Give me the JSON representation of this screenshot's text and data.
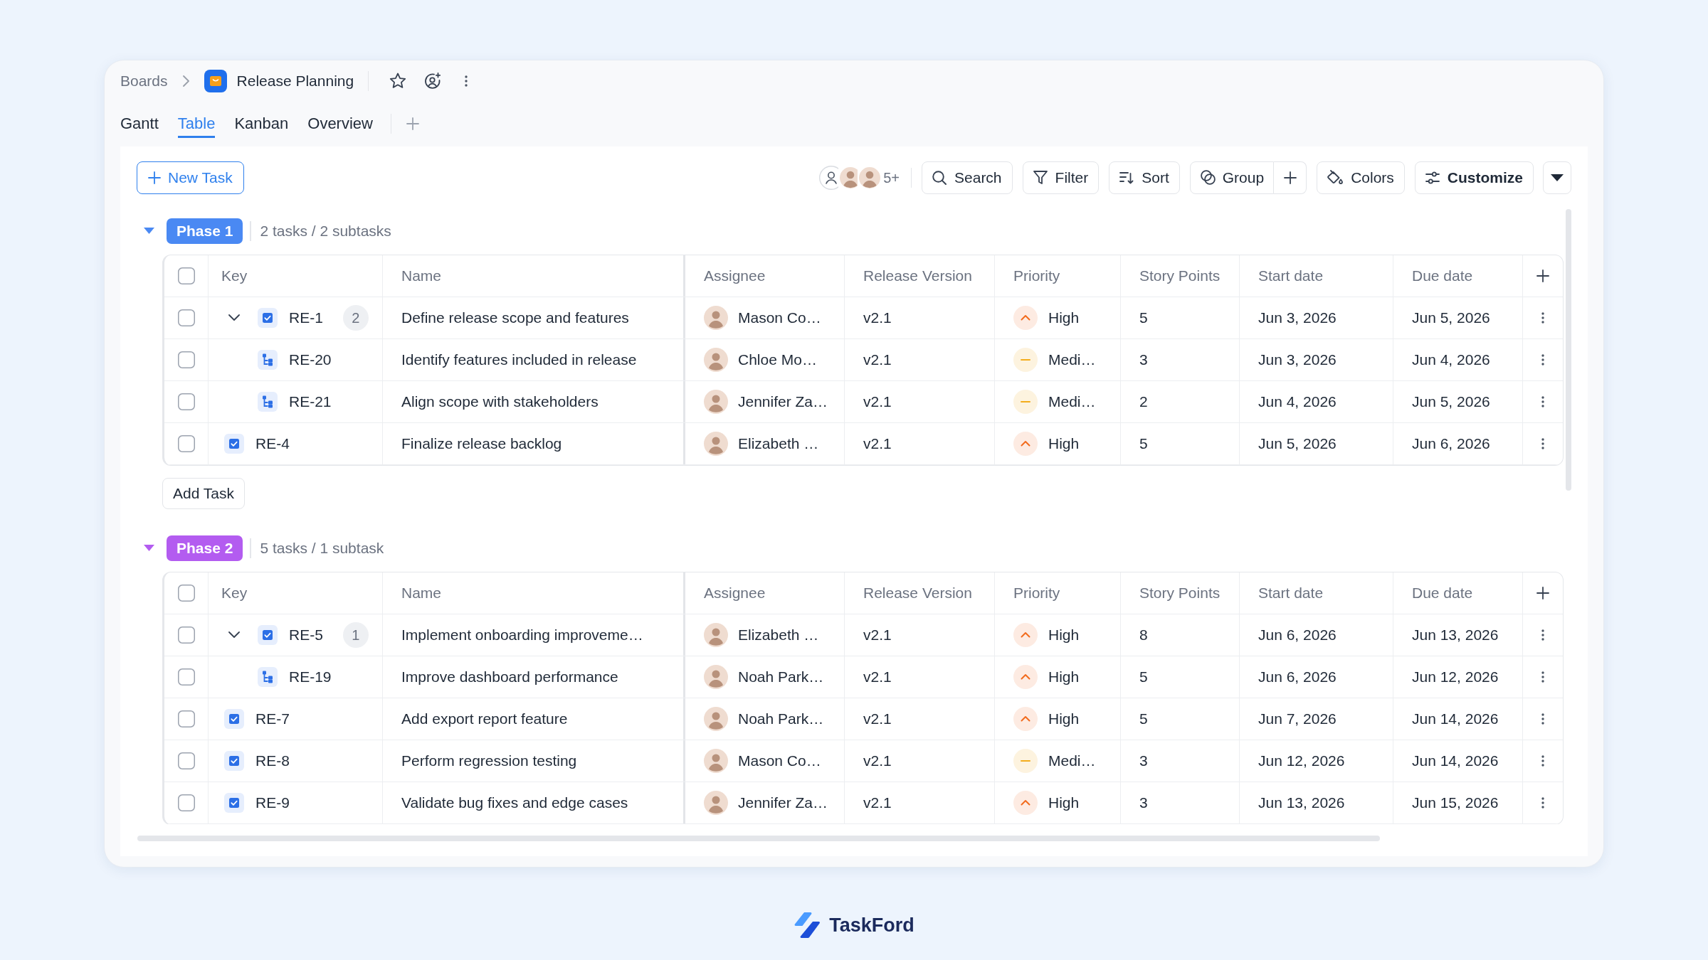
{
  "breadcrumb": {
    "parent": "Boards",
    "board": "Release Planning"
  },
  "tabs": [
    {
      "label": "Gantt",
      "selected": false
    },
    {
      "label": "Table",
      "selected": true
    },
    {
      "label": "Kanban",
      "selected": false
    },
    {
      "label": "Overview",
      "selected": false
    }
  ],
  "toolbar": {
    "new_task": "New Task",
    "members_more": "5+",
    "buttons": [
      {
        "kind": "search",
        "label": "Search"
      },
      {
        "kind": "filter",
        "label": "Filter"
      },
      {
        "kind": "sort",
        "label": "Sort"
      },
      {
        "kind": "group",
        "label": "Group"
      },
      {
        "kind": "colors",
        "label": "Colors"
      },
      {
        "kind": "customize",
        "label": "Customize"
      }
    ]
  },
  "groups": [
    {
      "label": "Phase 1",
      "color": "#4a89f3",
      "expanded": true,
      "summary": "2 tasks / 2 subtasks",
      "header_checked": false,
      "columns": [
        "Key",
        "Name",
        "Assignee",
        "Release Version",
        "Priority",
        "Story Points",
        "Start date",
        "Due date"
      ],
      "rows": [
        {
          "selected": false,
          "kind": "task",
          "key": "RE-1",
          "count": "2",
          "expanded": true,
          "name": "Define release scope and features",
          "assignee": "Mason Co…",
          "version": "v2.1",
          "priority": {
            "kind": "high",
            "label": "High"
          },
          "points": "5",
          "start": "Jun 3, 2026",
          "due": "Jun 5, 2026",
          "children": [
            {
              "selected": false,
              "kind": "subtask",
              "key": "RE-20",
              "name": "Identify features included in release",
              "assignee": "Chloe Mo…",
              "version": "v2.1",
              "priority": {
                "kind": "medium",
                "label": "Medi…"
              },
              "points": "3",
              "start": "Jun 3, 2026",
              "due": "Jun 4, 2026"
            },
            {
              "selected": false,
              "kind": "subtask",
              "key": "RE-21",
              "name": "Align scope with stakeholders",
              "assignee": "Jennifer Za…",
              "version": "v2.1",
              "priority": {
                "kind": "medium",
                "label": "Medi…"
              },
              "points": "2",
              "start": "Jun 4, 2026",
              "due": "Jun 5, 2026"
            }
          ]
        },
        {
          "selected": false,
          "kind": "task",
          "key": "RE-4",
          "name": "Finalize release backlog",
          "assignee": "Elizabeth …",
          "version": "v2.1",
          "priority": {
            "kind": "high",
            "label": "High"
          },
          "points": "5",
          "start": "Jun 5, 2026",
          "due": "Jun 6, 2026"
        }
      ],
      "add_task": "Add Task"
    },
    {
      "label": "Phase 2",
      "color": "#b35cf0",
      "expanded": true,
      "summary": "5 tasks / 1 subtask",
      "header_checked": false,
      "columns": [
        "Key",
        "Name",
        "Assignee",
        "Release Version",
        "Priority",
        "Story Points",
        "Start date",
        "Due date"
      ],
      "rows": [
        {
          "selected": false,
          "kind": "task",
          "key": "RE-5",
          "count": "1",
          "expanded": true,
          "name": "Implement onboarding improveme…",
          "assignee": "Elizabeth …",
          "version": "v2.1",
          "priority": {
            "kind": "high",
            "label": "High"
          },
          "points": "8",
          "start": "Jun 6, 2026",
          "due": "Jun 13, 2026",
          "children": [
            {
              "selected": false,
              "kind": "subtask",
              "key": "RE-19",
              "name": "Improve dashboard performance",
              "assignee": "Noah Park…",
              "version": "v2.1",
              "priority": {
                "kind": "high",
                "label": "High"
              },
              "points": "5",
              "start": "Jun 6, 2026",
              "due": "Jun 12, 2026"
            }
          ]
        },
        {
          "selected": false,
          "kind": "task",
          "key": "RE-7",
          "name": "Add export report feature",
          "assignee": "Noah Park…",
          "version": "v2.1",
          "priority": {
            "kind": "high",
            "label": "High"
          },
          "points": "5",
          "start": "Jun 7, 2026",
          "due": "Jun 14, 2026"
        },
        {
          "selected": false,
          "kind": "task",
          "key": "RE-8",
          "name": "Perform regression testing",
          "assignee": "Mason Co…",
          "version": "v2.1",
          "priority": {
            "kind": "medium",
            "label": "Medi…"
          },
          "points": "3",
          "start": "Jun 12, 2026",
          "due": "Jun 14, 2026"
        },
        {
          "selected": false,
          "kind": "task",
          "key": "RE-9",
          "name": "Validate bug fixes and edge cases",
          "assignee": "Jennifer Za…",
          "version": "v2.1",
          "priority": {
            "kind": "high",
            "label": "High"
          },
          "points": "3",
          "start": "Jun 13, 2026",
          "due": "Jun 15, 2026"
        }
      ]
    }
  ],
  "footer": {
    "brand": "TaskFord"
  }
}
